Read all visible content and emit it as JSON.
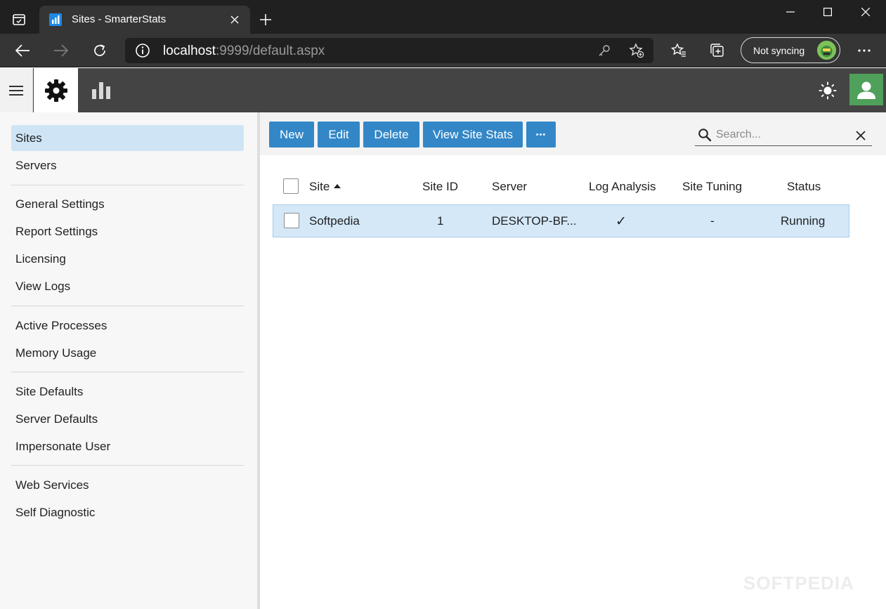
{
  "browser": {
    "tab_title": "Sites - SmarterStats",
    "url_host": "localhost",
    "url_rest": ":9999/default.aspx",
    "sync_label": "Not syncing"
  },
  "sidebar": {
    "groups": [
      [
        "Sites",
        "Servers"
      ],
      [
        "General Settings",
        "Report Settings",
        "Licensing",
        "View Logs"
      ],
      [
        "Active Processes",
        "Memory Usage"
      ],
      [
        "Site Defaults",
        "Server Defaults",
        "Impersonate User"
      ],
      [
        "Web Services",
        "Self Diagnostic"
      ]
    ],
    "active": "Sites"
  },
  "toolbar": {
    "new_label": "New",
    "edit_label": "Edit",
    "delete_label": "Delete",
    "view_stats_label": "View Site Stats",
    "more_label": "•••",
    "search_placeholder": "Search..."
  },
  "grid": {
    "columns": [
      "Site",
      "Site ID",
      "Server",
      "Log Analysis",
      "Site Tuning",
      "Status"
    ],
    "rows": [
      {
        "site": "Softpedia",
        "site_id": "1",
        "server": "DESKTOP-BF...",
        "log_analysis": "✓",
        "site_tuning": "-",
        "status": "Running"
      }
    ]
  },
  "watermark": "SOFTPEDIA",
  "colors": {
    "accent": "#3387c7",
    "selected_row": "#d4e8f8",
    "active_sidebar": "#cfe5f6",
    "user_button": "#4fa05a",
    "header": "#444444"
  }
}
